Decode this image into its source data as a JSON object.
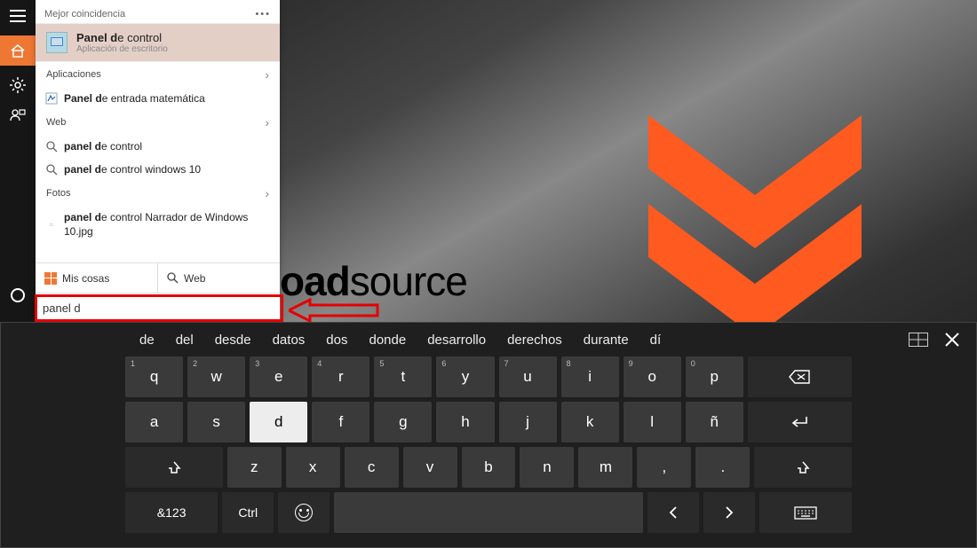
{
  "search": {
    "header": "Mejor coincidencia",
    "best": {
      "title_bold": "Panel d",
      "title_rest": "e control",
      "subtitle": "Aplicación de escritorio"
    },
    "sections": {
      "apps": "Aplicaciones",
      "web": "Web",
      "photos": "Fotos"
    },
    "rows": {
      "app1_bold": "Panel d",
      "app1_rest": "e entrada matemática",
      "web1_bold": "panel d",
      "web1_rest": "e control",
      "web2_bold": "panel d",
      "web2_rest": "e control windows 10",
      "photo1_bold": "panel d",
      "photo1_rest": "e control Narrador de Windows 10.jpg"
    },
    "tabs": {
      "mine": "Mis cosas",
      "web": "Web"
    },
    "query": "panel d"
  },
  "bg": {
    "text_bold": "oad",
    "text_rest": "source"
  },
  "suggestions": [
    "de",
    "del",
    "desde",
    "datos",
    "dos",
    "donde",
    "desarrollo",
    "derechos",
    "durante",
    "dí"
  ],
  "keyboard": {
    "row1": [
      {
        "k": "q",
        "n": "1"
      },
      {
        "k": "w",
        "n": "2"
      },
      {
        "k": "e",
        "n": "3"
      },
      {
        "k": "r",
        "n": "4"
      },
      {
        "k": "t",
        "n": "5"
      },
      {
        "k": "y",
        "n": "6"
      },
      {
        "k": "u",
        "n": "7"
      },
      {
        "k": "i",
        "n": "8"
      },
      {
        "k": "o",
        "n": "9"
      },
      {
        "k": "p",
        "n": "0"
      }
    ],
    "row2": [
      "a",
      "s",
      "d",
      "f",
      "g",
      "h",
      "j",
      "k",
      "l",
      "ñ"
    ],
    "row3": [
      "z",
      "x",
      "c",
      "v",
      "b",
      "n",
      "m",
      ",",
      "."
    ],
    "bottom": {
      "sym": "&123",
      "ctrl": "Ctrl"
    }
  }
}
